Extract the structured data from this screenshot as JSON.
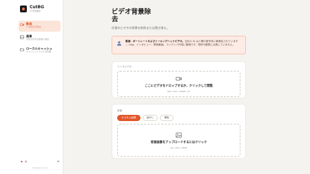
{
  "brand": {
    "name": "CutBG",
    "sub": "AI 背景除去"
  },
  "sidebar": {
    "items": [
      {
        "label": "動画",
        "sub": "AI 動画背景除去",
        "icon": "video-icon",
        "active": true
      },
      {
        "label": "画像",
        "sub": "写真の背景を即座に除去",
        "icon": "image-icon",
        "active": false
      },
      {
        "label": "ローカルキャッシュ",
        "sub": "キャッシュファイルの管理",
        "icon": "folder-icon",
        "active": false
      }
    ],
    "language": "JA",
    "powered": "Powered by AI"
  },
  "main": {
    "title": "ビデオ背景除去",
    "subtitle": "任意のビデオの背景を削除または置き換え。",
    "notice": {
      "bold": "最適：ポートレートおよびトーキングヘッドビデオ。",
      "text": "当社の AI は人間の被写体に最適化されています — vlog、インタビュー、教育動画、コンテンツ作成に最適です。物体や動物には適していません。"
    },
    "source": {
      "label": "ソースビデオ",
      "drop_title": "ここにビデオをドロップするか、クリックして閲覧",
      "drop_hint": "MP4, MOV, WEBM, AVI"
    },
    "background": {
      "label": "背景",
      "chips": [
        "カスタム画像",
        "ぼかし",
        "単色"
      ],
      "active_chip": 0,
      "drop_title": "背景画像をアップロードするにはクリック",
      "drop_hint": "JPG, PNG, WEBP"
    }
  },
  "colors": {
    "accent": "#e2552a",
    "accent_soft": "#fbe4d8",
    "notice_bg": "#fdece5"
  }
}
